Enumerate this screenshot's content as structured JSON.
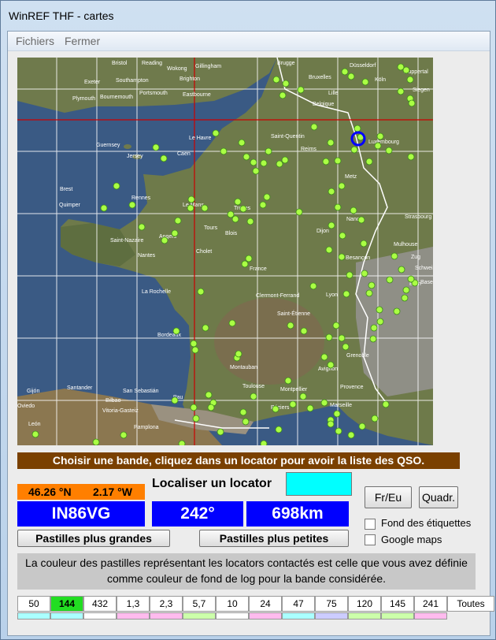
{
  "window": {
    "title": "WinREF THF - cartes"
  },
  "menu": {
    "items": [
      "Fichiers",
      "Fermer"
    ]
  },
  "map": {
    "cities": [
      "Bristol",
      "Reading",
      "Wokong",
      "Gillingham",
      "Brugge",
      "Düsseldorf",
      "Wuppertal",
      "Exeter",
      "Southampton",
      "Brighton",
      "Bruxelles",
      "Köln",
      "Plymouth",
      "Bournemouth",
      "Portsmouth",
      "Eastbourne",
      "Lille",
      "Belgique",
      "Siegen",
      "Guernsey",
      "Le Havre",
      "Saint-Quentin",
      "Reims",
      "Luxembourg",
      "Jersey",
      "Caen",
      "Metz",
      "Brest",
      "Rennes",
      "Strasbourg",
      "Quimper",
      "Le Mans",
      "Troyes",
      "Nancy",
      "Mulhouse",
      "Saint-Nazaire",
      "Angers",
      "Tours",
      "Blois",
      "Besançon",
      "Nantes",
      "Cholet",
      "Dijon",
      "Basel",
      "France",
      "La Rochelle",
      "Clermont-Ferrand",
      "Lyon",
      "Saint-Étienne",
      "Bordeaux",
      "Grenoble",
      "Montauban",
      "Avignon",
      "Toulouse",
      "Gijón",
      "Santander",
      "San Sebastián",
      "Pau",
      "Montpellier",
      "Marseille",
      "Vitoria-Gasteiz",
      "Béziers",
      "Provence",
      "León",
      "Pamplona",
      "Oviedo",
      "Bilbao",
      "Zug",
      "Schweiz",
      "Bern"
    ]
  },
  "banner": "Choisir une bande, cliquez dans un locator  pour avoir la liste des QSO.",
  "coords": {
    "lat": "46.26 °N",
    "lon": "2.17 °W"
  },
  "locator": "IN86VG",
  "bearing": "242°",
  "distance": "698km",
  "locate": {
    "label": "Localiser un locator",
    "value": ""
  },
  "buttons": {
    "freu": "Fr/Eu",
    "quadr": "Quadr.",
    "bigger": "Pastilles plus grandes",
    "smaller": "Pastilles plus petites"
  },
  "checks": {
    "fond": "Fond des étiquettes",
    "google": "Google maps"
  },
  "info": "La couleur des pastilles représentant les locators contactés est celle que vous avez définie comme couleur de fond de log pour la bande considérée.",
  "bands": [
    {
      "label": "50",
      "active": false,
      "color": "#aaffff"
    },
    {
      "label": "144",
      "active": true,
      "color": "#aaffff"
    },
    {
      "label": "432",
      "active": false,
      "color": "#ffffff"
    },
    {
      "label": "1,3",
      "active": false,
      "color": "#ffbbee"
    },
    {
      "label": "2,3",
      "active": false,
      "color": "#ffbbee"
    },
    {
      "label": "5,7",
      "active": false,
      "color": "#ccffaa"
    },
    {
      "label": "10",
      "active": false,
      "color": "#ffffff"
    },
    {
      "label": "24",
      "active": false,
      "color": "#ffbbee"
    },
    {
      "label": "47",
      "active": false,
      "color": "#aaffff"
    },
    {
      "label": "75",
      "active": false,
      "color": "#ccccff"
    },
    {
      "label": "120",
      "active": false,
      "color": "#ccffaa"
    },
    {
      "label": "145",
      "active": false,
      "color": "#ccffaa"
    },
    {
      "label": "241",
      "active": false,
      "color": "#ffbbee"
    },
    {
      "label": "Toutes",
      "active": false,
      "color": ""
    }
  ],
  "colors": {
    "banner": "#7a4000",
    "coord": "#ff7f00",
    "blue": "#0000ff",
    "cyan": "#00ffff",
    "dot": "#aaff44",
    "crosshair": "#cc0000",
    "active_band": "#22dd22"
  }
}
